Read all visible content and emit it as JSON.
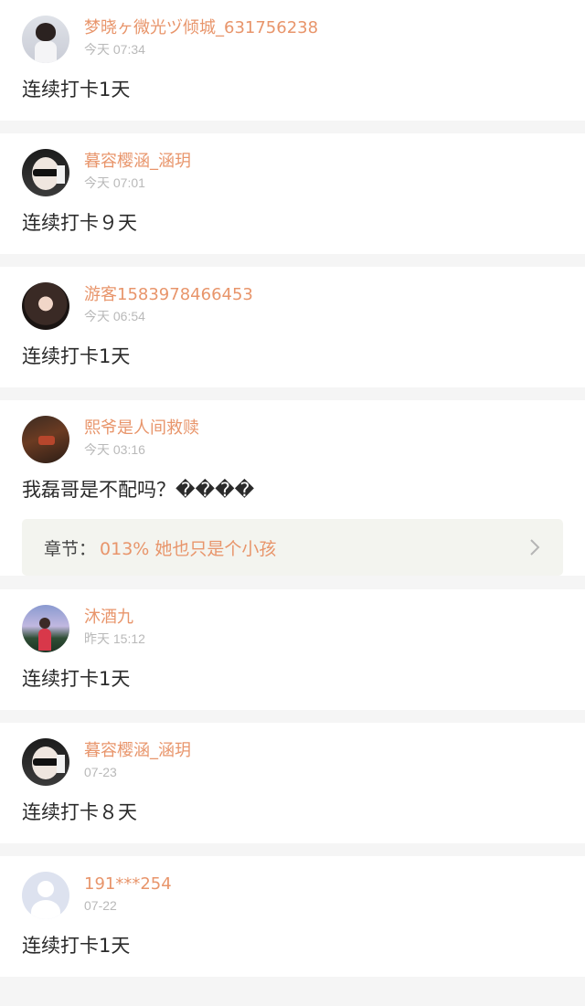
{
  "comments": [
    {
      "username": "梦晓ヶ微光ヅ倾城_631756238",
      "time": "今天 07:34",
      "content": "连续打卡1天"
    },
    {
      "username": "暮容樱涵_涵玥",
      "time": "今天 07:01",
      "content": "连续打卡９天"
    },
    {
      "username": "游客1583978466453",
      "time": "今天 06:54",
      "content": "连续打卡1天"
    },
    {
      "username": "熙爷是人间救赎",
      "time": "今天 03:16",
      "content": "我磊哥是不配吗？����",
      "chapter": {
        "label": "章节：",
        "title": "013% 她也只是个小孩"
      }
    },
    {
      "username": "沐酒九",
      "time": "昨天 15:12",
      "content": "连续打卡1天"
    },
    {
      "username": "暮容樱涵_涵玥",
      "time": "07-23",
      "content": "连续打卡８天"
    },
    {
      "username": "191***254",
      "time": "07-22",
      "content": "连续打卡1天"
    }
  ],
  "colors": {
    "username": "#e8956b",
    "time": "#b9b9b9",
    "background": "#f5f5f5"
  },
  "icons": {
    "chapter_link": "chevron-right-icon"
  }
}
